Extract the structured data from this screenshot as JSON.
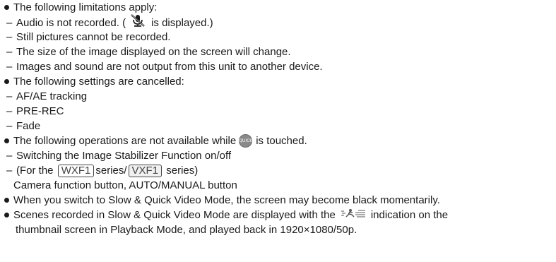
{
  "lines": {
    "l1": "The following limitations apply:",
    "l2a": "Audio is not recorded. (",
    "l2b": "is displayed.)",
    "l3": "Still pictures cannot be recorded.",
    "l4": "The size of the image displayed on the screen will change.",
    "l5": "Images and sound are not output from this unit to another device.",
    "l6": "The following settings are cancelled:",
    "l7": "AF/AE tracking",
    "l8": "PRE-REC",
    "l9": "Fade",
    "l10a": "The following operations are not available while",
    "l10b": "is touched.",
    "l11": "Switching the Image Stabilizer Function on/off",
    "l12a": "(For the",
    "l12_model1": "WXF1",
    "l12b": "series/",
    "l12_model2": "VXF1",
    "l12c": "series)",
    "l13": "Camera function button, AUTO/MANUAL button",
    "l14": "When you switch to Slow & Quick Video Mode, the screen may become black momentarily.",
    "l15a": "Scenes recorded in Slow & Quick Video Mode are displayed with the",
    "l15b": "indication on the",
    "l16": "thumbnail screen in Playback Mode, and played back in 1920×1080/50p."
  },
  "dash": "–",
  "icons": {
    "mute": "audio-mute-icon",
    "quick": "quick-button-icon",
    "slow": "slow-quick-video-icon"
  },
  "quick_icon_text": "QUICK"
}
